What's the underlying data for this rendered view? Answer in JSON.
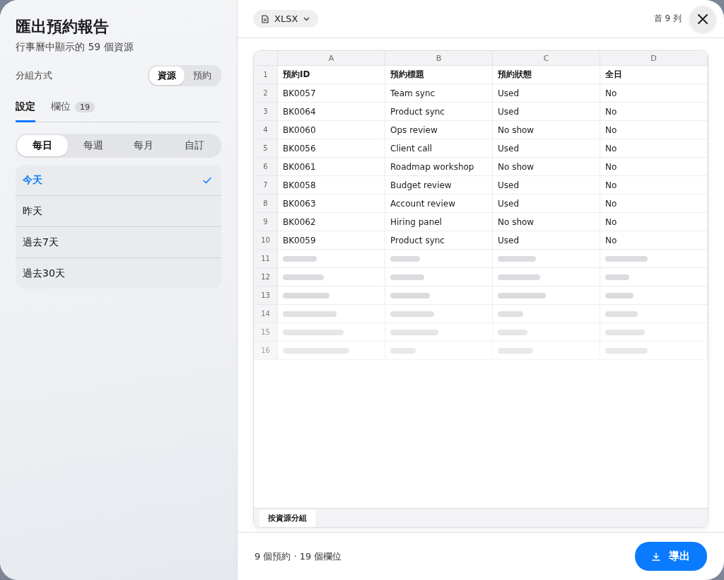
{
  "title": "匯出預約報告",
  "subtitle": "行事曆中顯示的 59 個資源",
  "group_by": {
    "label": "分組方式",
    "options": [
      {
        "label": "資源",
        "selected": true
      },
      {
        "label": "預約",
        "selected": false
      }
    ]
  },
  "tabs": [
    {
      "label": "設定",
      "selected": true
    },
    {
      "label": "欄位",
      "badge": "19",
      "selected": false
    }
  ],
  "periods": [
    {
      "label": "每日",
      "selected": true
    },
    {
      "label": "每週",
      "selected": false
    },
    {
      "label": "每月",
      "selected": false
    },
    {
      "label": "自訂",
      "selected": false
    }
  ],
  "ranges": [
    {
      "label": "今天",
      "selected": true
    },
    {
      "label": "昨天",
      "selected": false
    },
    {
      "label": "過去7天",
      "selected": false
    },
    {
      "label": "過去30天",
      "selected": false
    }
  ],
  "format": {
    "label": "XLSX"
  },
  "preview_note": "首 9 列",
  "sheet": {
    "columns": [
      "A",
      "B",
      "C",
      "D"
    ],
    "rows": [
      {
        "number": "1",
        "kind": "header",
        "cells": [
          "預約ID",
          "預約標題",
          "預約狀態",
          "全日"
        ]
      },
      {
        "number": "2",
        "kind": "data",
        "cells": [
          "BK0057",
          "Team sync",
          "Used",
          "No"
        ]
      },
      {
        "number": "3",
        "kind": "data",
        "cells": [
          "BK0064",
          "Product sync",
          "Used",
          "No"
        ]
      },
      {
        "number": "4",
        "kind": "data",
        "cells": [
          "BK0060",
          "Ops review",
          "No show",
          "No"
        ]
      },
      {
        "number": "5",
        "kind": "data",
        "cells": [
          "BK0056",
          "Client call",
          "Used",
          "No"
        ]
      },
      {
        "number": "6",
        "kind": "data",
        "cells": [
          "BK0061",
          "Roadmap workshop",
          "No show",
          "No"
        ]
      },
      {
        "number": "7",
        "kind": "data",
        "cells": [
          "BK0058",
          "Budget review",
          "Used",
          "No"
        ]
      },
      {
        "number": "8",
        "kind": "data",
        "cells": [
          "BK0063",
          "Account review",
          "Used",
          "No"
        ]
      },
      {
        "number": "9",
        "kind": "data",
        "cells": [
          "BK0062",
          "Hiring panel",
          "No show",
          "No"
        ]
      },
      {
        "number": "10",
        "kind": "data",
        "cells": [
          "BK0059",
          "Product sync",
          "Used",
          "No"
        ]
      },
      {
        "number": "11",
        "kind": "placeholder"
      },
      {
        "number": "12",
        "kind": "placeholder"
      },
      {
        "number": "13",
        "kind": "placeholder"
      },
      {
        "number": "14",
        "kind": "placeholder"
      },
      {
        "number": "15",
        "kind": "placeholder"
      },
      {
        "number": "16",
        "kind": "placeholder"
      }
    ],
    "sheet_tab": "按資源分組"
  },
  "footer": {
    "summary": "9 個預約 · 19 個欄位",
    "export_button": "導出"
  }
}
